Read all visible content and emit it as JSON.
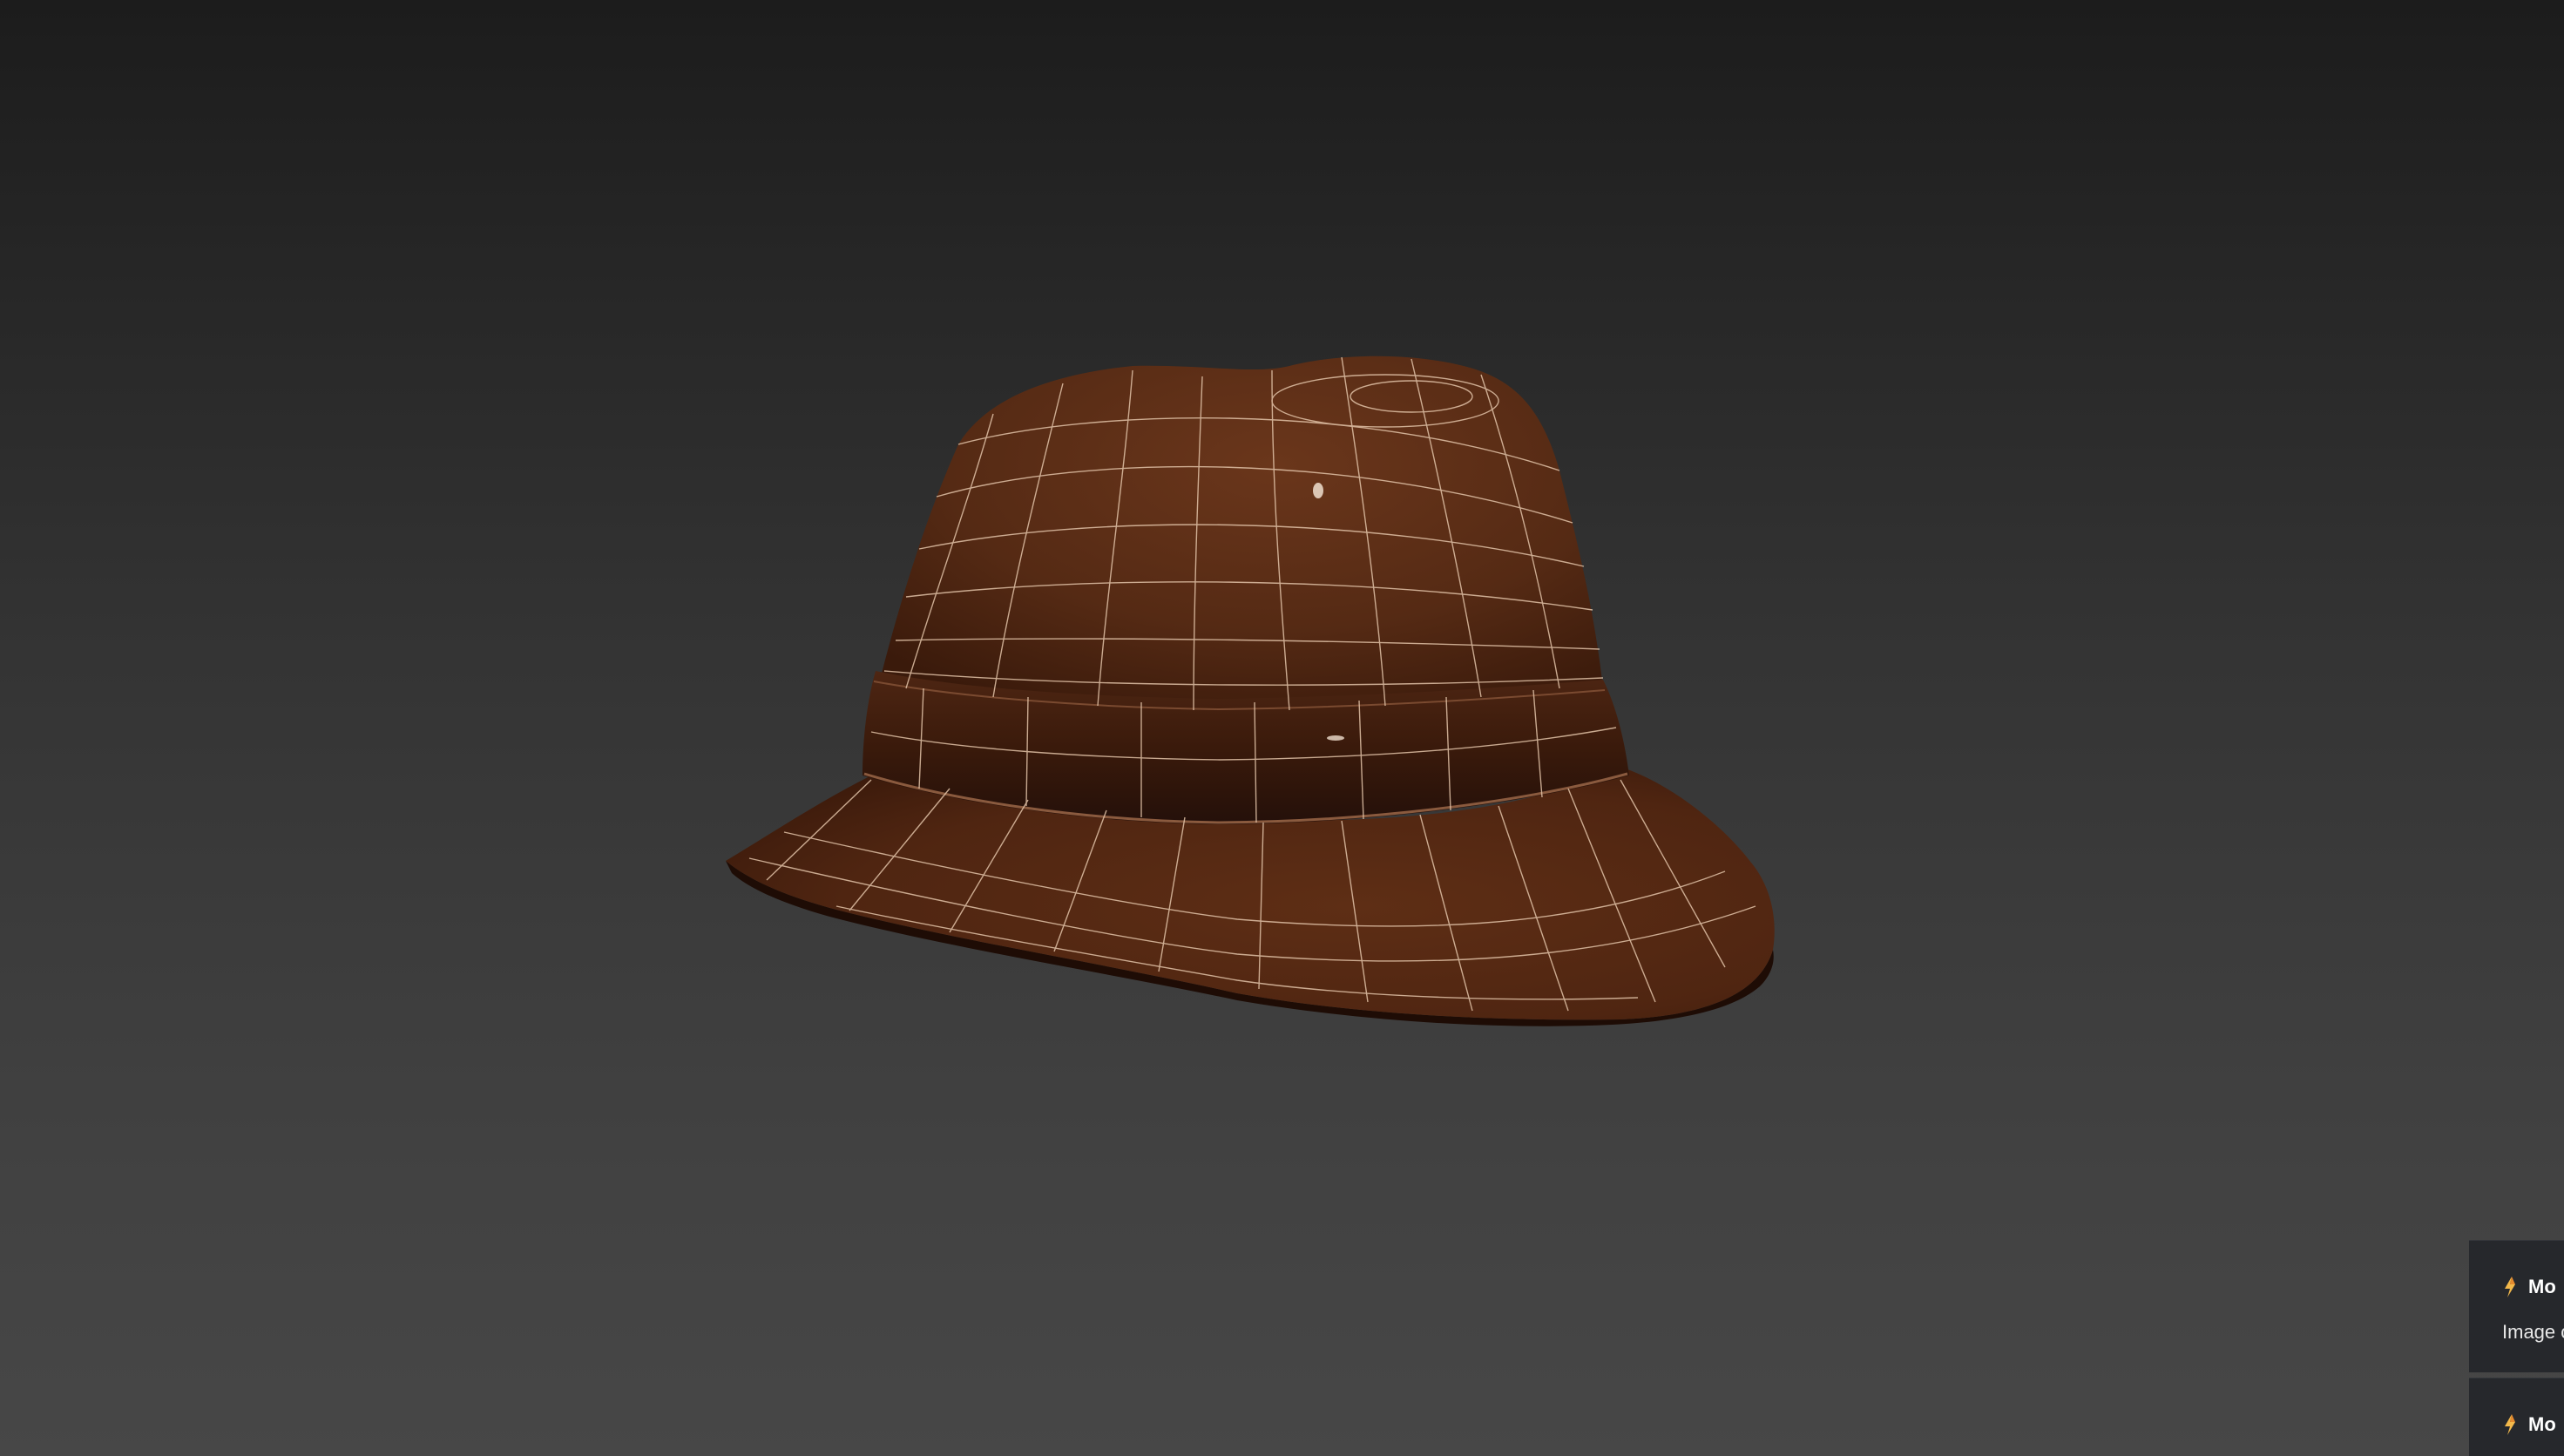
{
  "viewport": {
    "background_top": "#1c1c1c",
    "background_bottom": "#474747",
    "object": "fedora-hat-wireframe",
    "object_colors": {
      "base": "#5a2c15",
      "shadow": "#2a1208",
      "wire": "#e2c3a8"
    }
  },
  "notifications": [
    {
      "icon": "lightning-bolt-icon",
      "title": "Mo",
      "body": "Image c"
    },
    {
      "icon": "lightning-bolt-icon",
      "title": "Mo",
      "body": ""
    }
  ]
}
